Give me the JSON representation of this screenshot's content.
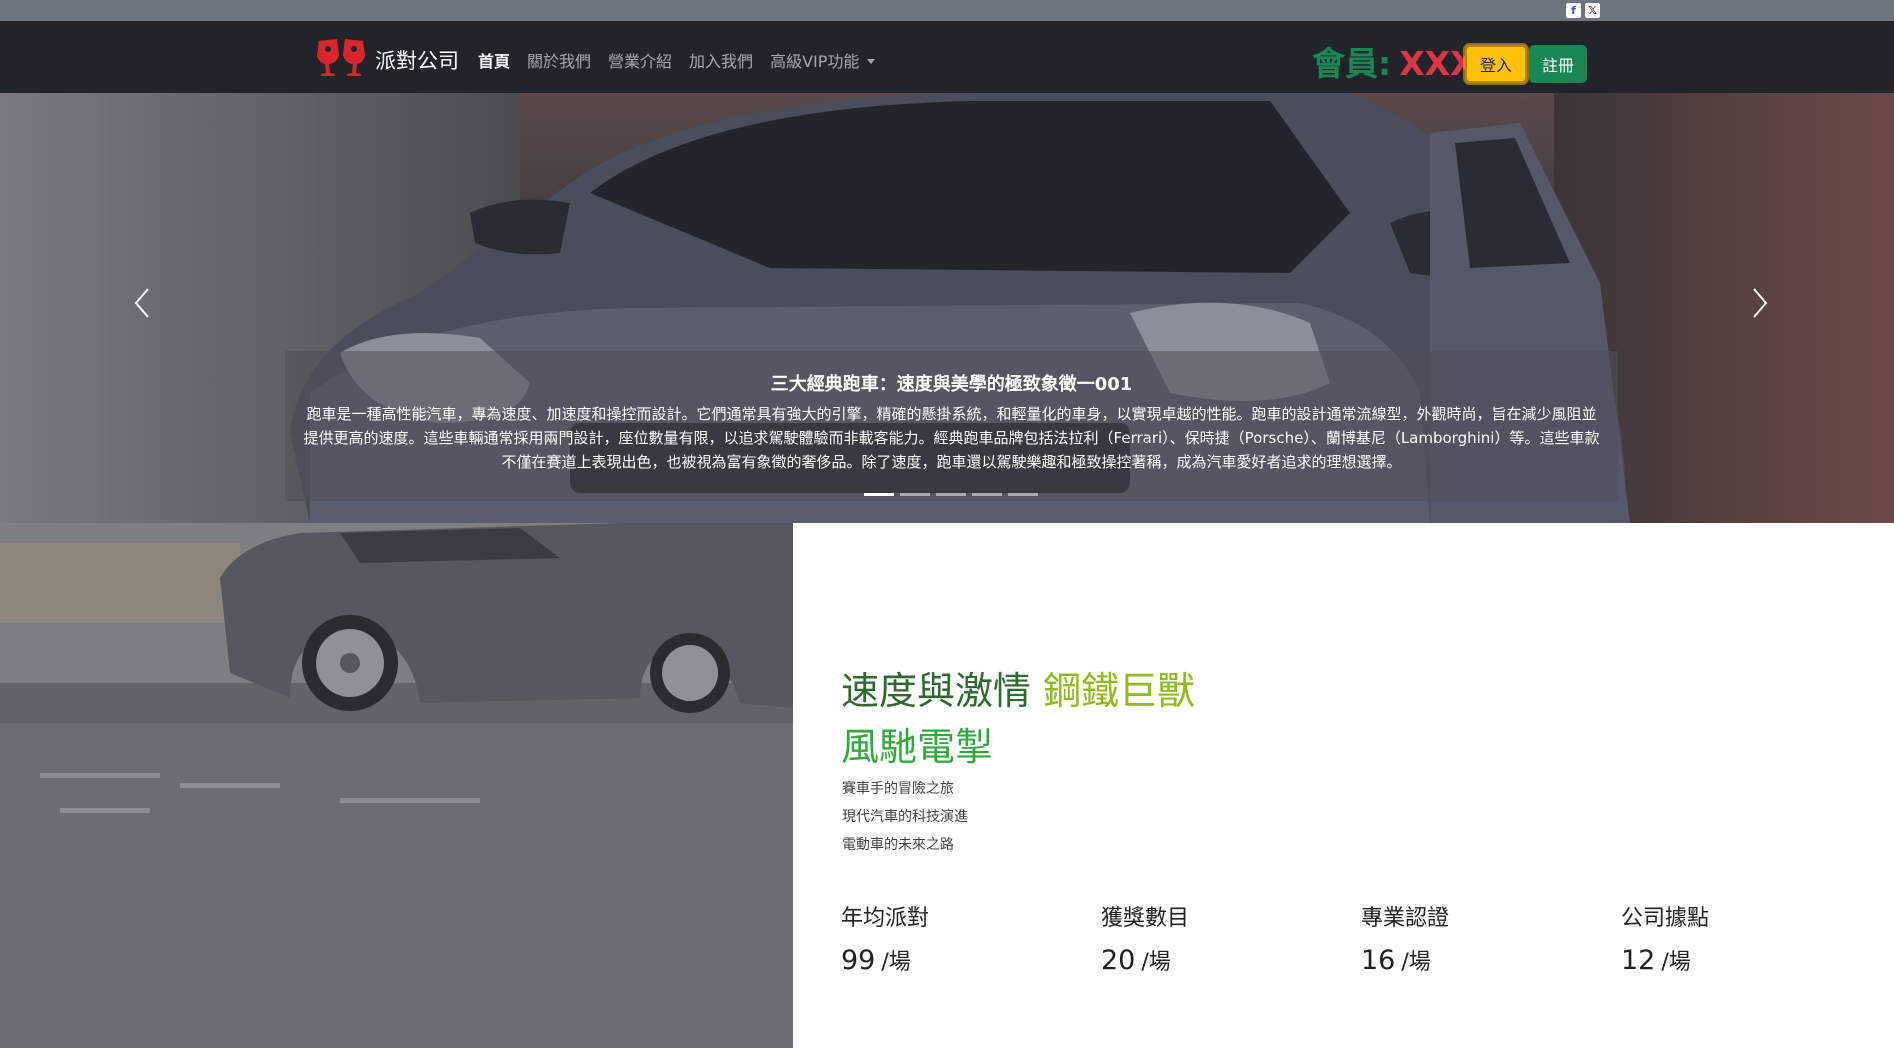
{
  "social": {
    "facebook": "f",
    "x": "𝕏"
  },
  "navbar": {
    "brand": "派對公司",
    "items": [
      {
        "label": "首頁",
        "active": true
      },
      {
        "label": "關於我們"
      },
      {
        "label": "營業介紹"
      },
      {
        "label": "加入我們"
      },
      {
        "label": "高級VIP功能",
        "dropdown": true
      }
    ],
    "member_label": "會員:",
    "member_name": "XXX",
    "login_label": "登入",
    "register_label": "註冊"
  },
  "hero": {
    "title": "三大經典跑車：速度與美學的極致象徵一001",
    "text": "跑車是一種高性能汽車，專為速度、加速度和操控而設計。它們通常具有強大的引擎，精確的懸掛系統，和輕量化的車身，以實現卓越的性能。跑車的設計通常流線型，外觀時尚，旨在減少風阻並提供更高的速度。這些車輛通常採用兩門設計，座位數量有限，以追求駕駛體驗而非載客能力。經典跑車品牌包括法拉利（Ferrari）、保時捷（Porsche）、蘭博基尼（Lamborghini）等。這些車款不僅在賽道上表現出色，也被視為富有象徵的奢侈品。除了速度，跑車還以駕駛樂趣和極致操控著稱，成為汽車愛好者追求的理想選擇。",
    "slide_count": 5,
    "active_slide": 1
  },
  "feature": {
    "headline_1": "速度與激情",
    "headline_2": "鋼鐵巨獸",
    "headline_3": "風馳電掣",
    "items": [
      "賽車手的冒險之旅",
      "現代汽車的科技演進",
      "電動車的未來之路"
    ]
  },
  "stats": [
    {
      "label": "年均派對",
      "value": "99",
      "unit": "/場"
    },
    {
      "label": "獲獎數目",
      "value": "20",
      "unit": "/場"
    },
    {
      "label": "專業認證",
      "value": "16",
      "unit": "/場"
    },
    {
      "label": "公司據點",
      "value": "12",
      "unit": "/場"
    }
  ],
  "colors": {
    "navbar_bg": "#212529",
    "topbar_bg": "#6c757d",
    "member_label": "#198754",
    "member_name": "#dc3545",
    "login_bg": "#ffc107",
    "register_bg": "#198754",
    "headline_dark": "#2d6a2d",
    "headline_lime": "#8fbc1a",
    "headline_green": "#2eaa3a"
  }
}
